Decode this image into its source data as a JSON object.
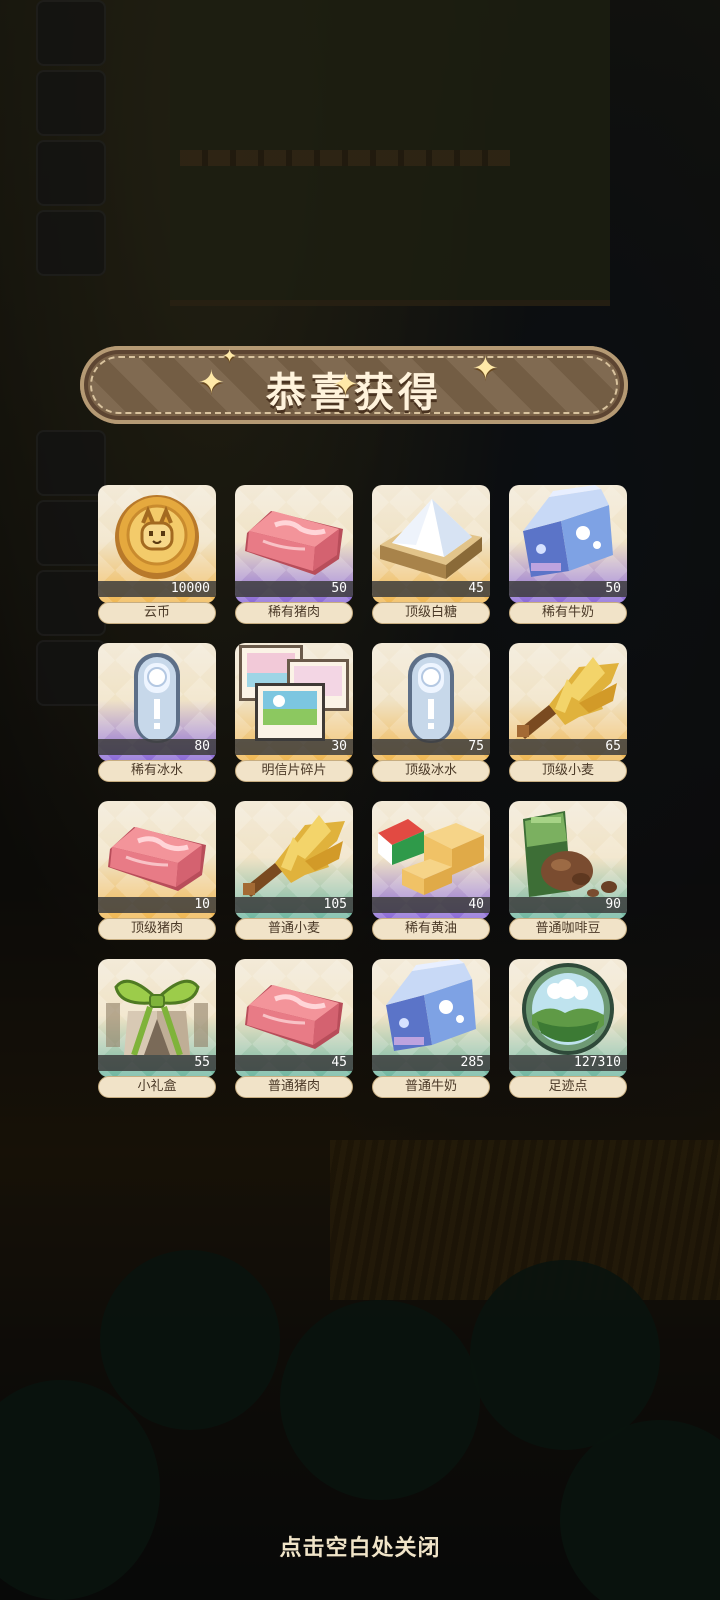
{
  "title": "恭喜获得",
  "footer_tip": "点击空白处关闭",
  "colors": {
    "tier_gold": "#f0b752",
    "tier_purple": "#8a69d8",
    "tier_teal": "#6fb7a2"
  },
  "rewards": [
    {
      "name": "云币",
      "qty": "10000",
      "icon": "coin-icon",
      "tier": "gold"
    },
    {
      "name": "稀有猪肉",
      "qty": "50",
      "icon": "pork-icon",
      "tier": "purple"
    },
    {
      "name": "顶级白糖",
      "qty": "45",
      "icon": "sugar-icon",
      "tier": "gold"
    },
    {
      "name": "稀有牛奶",
      "qty": "50",
      "icon": "milk-icon",
      "tier": "purple"
    },
    {
      "name": "稀有冰水",
      "qty": "80",
      "icon": "ice-water-icon",
      "tier": "purple"
    },
    {
      "name": "明信片碎片",
      "qty": "30",
      "icon": "postcard-icon",
      "tier": "gold"
    },
    {
      "name": "顶级冰水",
      "qty": "75",
      "icon": "ice-water-icon",
      "tier": "gold"
    },
    {
      "name": "顶级小麦",
      "qty": "65",
      "icon": "wheat-icon",
      "tier": "gold"
    },
    {
      "name": "顶级猪肉",
      "qty": "10",
      "icon": "pork-icon",
      "tier": "gold"
    },
    {
      "name": "普通小麦",
      "qty": "105",
      "icon": "wheat-icon",
      "tier": "teal"
    },
    {
      "name": "稀有黄油",
      "qty": "40",
      "icon": "butter-icon",
      "tier": "purple"
    },
    {
      "name": "普通咖啡豆",
      "qty": "90",
      "icon": "coffee-bean-icon",
      "tier": "teal"
    },
    {
      "name": "小礼盒",
      "qty": "55",
      "icon": "gift-box-icon",
      "tier": "teal"
    },
    {
      "name": "普通猪肉",
      "qty": "45",
      "icon": "pork-icon",
      "tier": "teal"
    },
    {
      "name": "普通牛奶",
      "qty": "285",
      "icon": "milk-icon",
      "tier": "teal"
    },
    {
      "name": "足迹点",
      "qty": "127310",
      "icon": "footprint-globe-icon",
      "tier": "teal"
    }
  ]
}
